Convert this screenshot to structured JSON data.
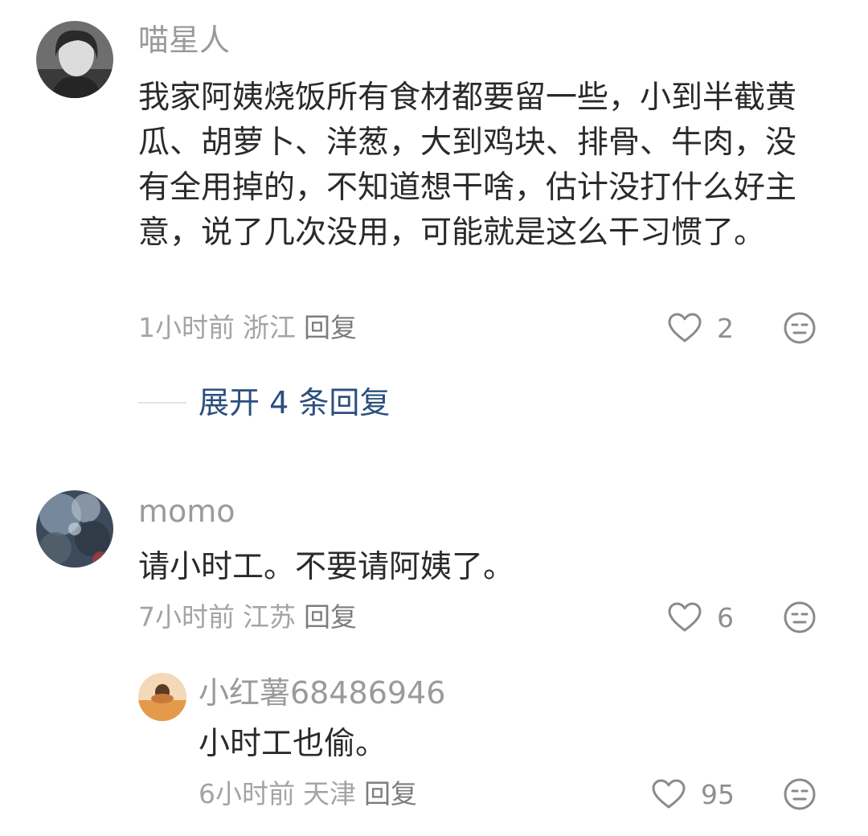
{
  "comments": [
    {
      "username": "喵星人",
      "text": "我家阿姨烧饭所有食材都要留一些，小到半截黄瓜、胡萝卜、洋葱，大到鸡块、排骨、牛肉，没有全用掉的，不知道想干啥，估计没打什么好主意，说了几次没用，可能就是这么干习惯了。",
      "time": "1小时前",
      "location": "浙江",
      "reply_label": "回复",
      "likes": "2",
      "expand_label": "展开 4 条回复"
    },
    {
      "username": "momo",
      "text": "请小时工。不要请阿姨了。",
      "time": "7小时前",
      "location": "江苏",
      "reply_label": "回复",
      "likes": "6",
      "replies": [
        {
          "username": "小红薯68486946",
          "text": "小时工也偷。",
          "time": "6小时前",
          "location": "天津",
          "reply_label": "回复",
          "likes": "95"
        }
      ]
    }
  ],
  "icons": {
    "like": "heart-outline-icon",
    "dislike": "neutral-face-icon"
  },
  "colors": {
    "link": "#2b4f7e",
    "meta": "#a4a4a4",
    "username": "#9a9a9a"
  }
}
